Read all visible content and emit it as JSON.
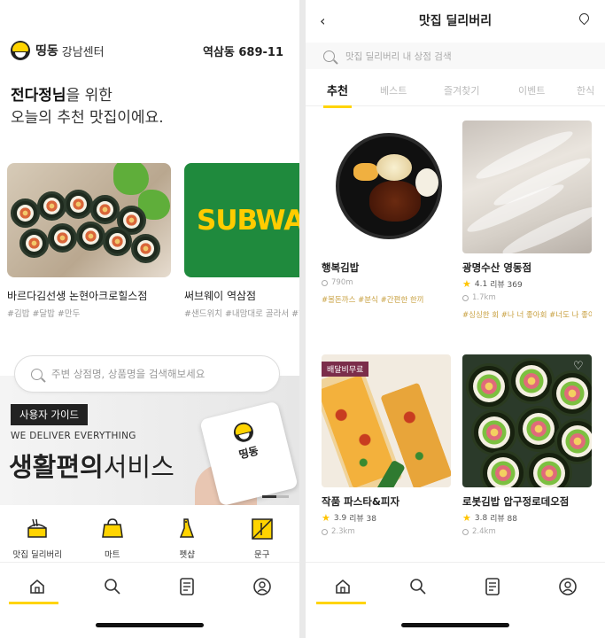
{
  "left": {
    "header": {
      "brand": "띵동",
      "center": "강남센터",
      "address": "역삼동 689-11"
    },
    "greeting": {
      "name": "전다정님",
      "line1_suffix": "을 위한",
      "line2": "오늘의 추천 맛집이에요."
    },
    "cards": [
      {
        "name": "바르다김선생 논현아크로힐스점",
        "tags": "#김밥 #달밥 #만두"
      },
      {
        "name": "써브웨이 역삼점",
        "tags": "#샌드위치 #내맘대로 골라서 #한 입",
        "logo_text": "SUBWA"
      }
    ],
    "search": {
      "placeholder": "주변 상점명, 상품명을 검색해보세요"
    },
    "banner": {
      "guide": "사용자 가이드",
      "tagline": "WE DELIVER EVERYTHING",
      "headline_bold": "생활편의",
      "headline_light": "서비스",
      "card_text": "띵동"
    },
    "categories": [
      {
        "label": "맛집 딜리버리",
        "icon": "food-delivery-icon"
      },
      {
        "label": "마트",
        "icon": "mart-icon"
      },
      {
        "label": "펫샵",
        "icon": "petshop-icon"
      },
      {
        "label": "문구",
        "icon": "stationery-icon"
      }
    ],
    "tabbar": [
      "home-icon",
      "search-icon",
      "orders-icon",
      "profile-icon"
    ]
  },
  "right": {
    "header": {
      "title": "맛집 딜리버리"
    },
    "search": {
      "placeholder": "맛집 딜리버리 내 상점 검색"
    },
    "tabs": [
      "추천",
      "베스트",
      "즐겨찾기",
      "이벤트",
      "한식"
    ],
    "items": [
      {
        "name": "행복김밥",
        "rating": "",
        "reviews": "",
        "distance": "790m",
        "tags": "#볼돈까스 #분식 #간편한 한끼"
      },
      {
        "name": "광명수산 영동점",
        "rating": "4.1",
        "reviews": "리뷰 369",
        "distance": "1.7km",
        "tags": "#싱싱한 회 #나 너 좋아회 #너도 나 좋아..."
      },
      {
        "name": "작품 파스타&피자",
        "rating": "3.9",
        "reviews": "리뷰 38",
        "distance": "2.3km",
        "tags": "",
        "badge": "배달비무료"
      },
      {
        "name": "로봇김밥 압구정로데오점",
        "rating": "3.8",
        "reviews": "리뷰 88",
        "distance": "2.4km",
        "tags": ""
      }
    ],
    "colors": {
      "accent": "#ffd400",
      "badge": "#7b2d4a",
      "star": "#ffc400"
    }
  }
}
